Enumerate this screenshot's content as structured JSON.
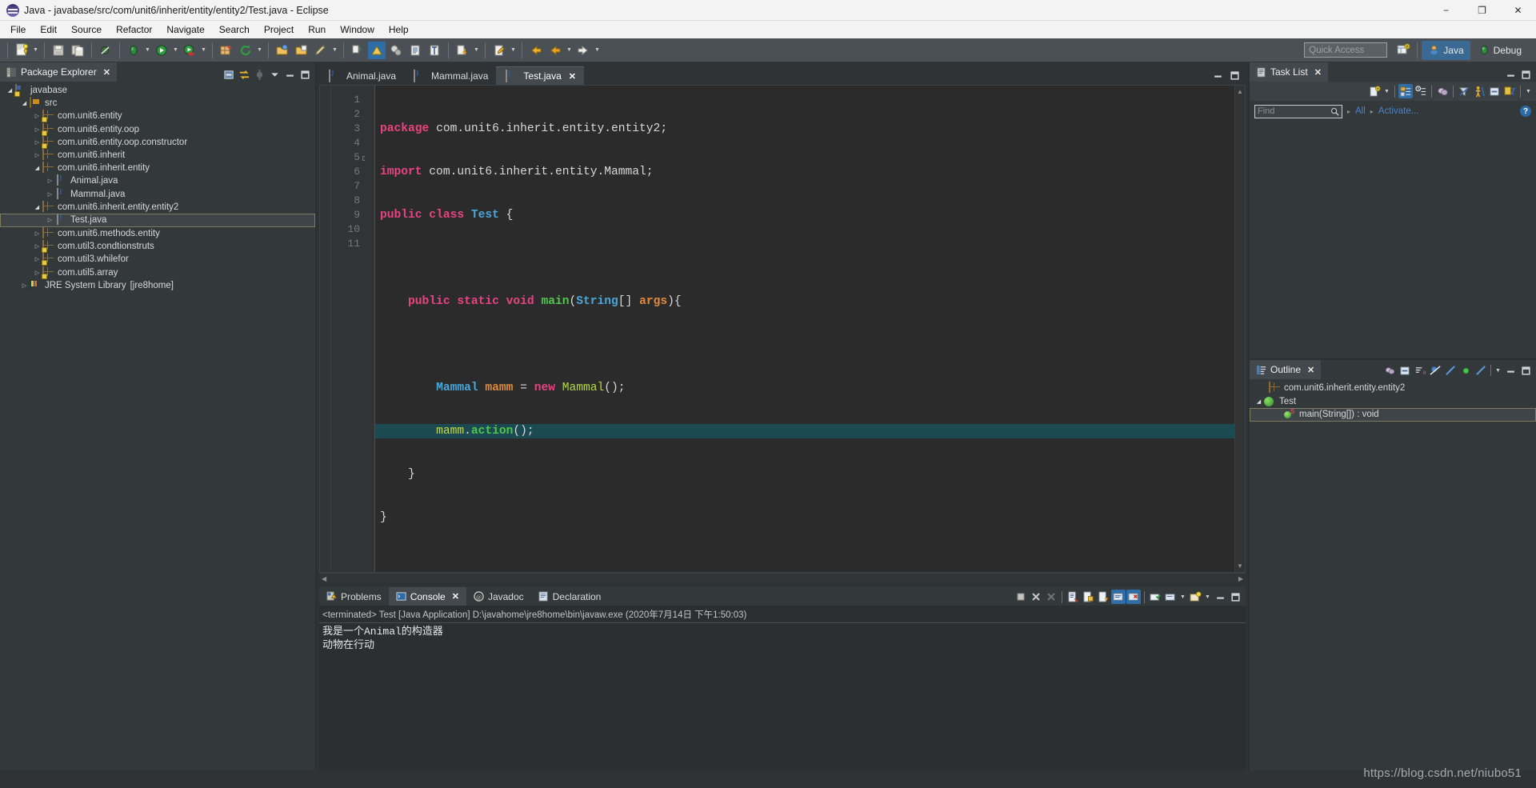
{
  "window": {
    "title": "Java - javabase/src/com/unit6/inherit/entity/entity2/Test.java - Eclipse",
    "minimize": "−",
    "maximize": "❐",
    "close": "✕"
  },
  "menubar": {
    "items": [
      "File",
      "Edit",
      "Source",
      "Refactor",
      "Navigate",
      "Search",
      "Project",
      "Run",
      "Window",
      "Help"
    ]
  },
  "toolbar": {
    "quick_access_placeholder": "Quick Access",
    "perspectives": [
      {
        "label": "Java",
        "active": true
      },
      {
        "label": "Debug",
        "active": false
      }
    ]
  },
  "package_explorer": {
    "tab_label": "Package Explorer",
    "close_glyph": "✕",
    "tree": [
      {
        "label": "javabase",
        "indent": 0,
        "twist": "open",
        "icon": "project-icon"
      },
      {
        "label": "src",
        "indent": 1,
        "twist": "open",
        "icon": "source-folder-icon"
      },
      {
        "label": "com.unit6.entity",
        "indent": 2,
        "twist": "closed",
        "icon": "package-locked-icon"
      },
      {
        "label": "com.unit6.entity.oop",
        "indent": 2,
        "twist": "closed",
        "icon": "package-locked-icon"
      },
      {
        "label": "com.unit6.entity.oop.constructor",
        "indent": 2,
        "twist": "closed",
        "icon": "package-locked-icon"
      },
      {
        "label": "com.unit6.inherit",
        "indent": 2,
        "twist": "closed",
        "icon": "package-icon"
      },
      {
        "label": "com.unit6.inherit.entity",
        "indent": 2,
        "twist": "open",
        "icon": "package-icon"
      },
      {
        "label": "Animal.java",
        "indent": 3,
        "twist": "closed",
        "icon": "java-file-icon"
      },
      {
        "label": "Mammal.java",
        "indent": 3,
        "twist": "closed",
        "icon": "java-file-icon"
      },
      {
        "label": "com.unit6.inherit.entity.entity2",
        "indent": 2,
        "twist": "open",
        "icon": "package-icon"
      },
      {
        "label": "Test.java",
        "indent": 3,
        "twist": "closed",
        "icon": "java-file-icon",
        "selected": true
      },
      {
        "label": "com.unit6.methods.entity",
        "indent": 2,
        "twist": "closed",
        "icon": "package-icon"
      },
      {
        "label": "com.util3.condtionstruts",
        "indent": 2,
        "twist": "closed",
        "icon": "package-locked-icon"
      },
      {
        "label": "com.util3.whilefor",
        "indent": 2,
        "twist": "closed",
        "icon": "package-locked-icon"
      },
      {
        "label": "com.util5.array",
        "indent": 2,
        "twist": "closed",
        "icon": "package-locked-icon"
      },
      {
        "label": "JRE System Library",
        "suffix": "[jre8home]",
        "indent": 1,
        "twist": "closed",
        "icon": "jre-library-icon"
      }
    ]
  },
  "editor": {
    "tabs": [
      {
        "label": "Animal.java",
        "active": false,
        "closable": false
      },
      {
        "label": "Mammal.java",
        "active": false,
        "closable": false
      },
      {
        "label": "Test.java",
        "active": true,
        "closable": true
      }
    ],
    "close_glyph": "✕",
    "line_numbers": [
      1,
      2,
      3,
      4,
      5,
      6,
      7,
      8,
      9,
      10,
      11
    ],
    "highlighted_line": 8,
    "code_lines": [
      {
        "n": 1,
        "tokens": [
          {
            "t": "package",
            "c": "kw"
          },
          {
            "t": " com.unit6.inherit.entity.entity2;",
            "c": "plain"
          }
        ]
      },
      {
        "n": 2,
        "tokens": [
          {
            "t": "import",
            "c": "kw"
          },
          {
            "t": " com.unit6.inherit.entity.Mammal;",
            "c": "plain"
          }
        ]
      },
      {
        "n": 3,
        "tokens": [
          {
            "t": "public class",
            "c": "kw"
          },
          {
            "t": " ",
            "c": "plain"
          },
          {
            "t": "Test",
            "c": "type"
          },
          {
            "t": " {",
            "c": "plain"
          }
        ]
      },
      {
        "n": 4,
        "tokens": [
          {
            "t": "",
            "c": "plain"
          }
        ]
      },
      {
        "n": 5,
        "tokens": [
          {
            "t": "    ",
            "c": "plain"
          },
          {
            "t": "public static void",
            "c": "kw"
          },
          {
            "t": " ",
            "c": "plain"
          },
          {
            "t": "main",
            "c": "green"
          },
          {
            "t": "(",
            "c": "plain"
          },
          {
            "t": "String",
            "c": "type"
          },
          {
            "t": "[] ",
            "c": "plain"
          },
          {
            "t": "args",
            "c": "field"
          },
          {
            "t": "){",
            "c": "plain"
          }
        ]
      },
      {
        "n": 6,
        "tokens": [
          {
            "t": "",
            "c": "plain"
          }
        ]
      },
      {
        "n": 7,
        "tokens": [
          {
            "t": "        ",
            "c": "plain"
          },
          {
            "t": "Mammal",
            "c": "type"
          },
          {
            "t": " ",
            "c": "plain"
          },
          {
            "t": "mamm",
            "c": "field"
          },
          {
            "t": " = ",
            "c": "plain"
          },
          {
            "t": "new",
            "c": "kw"
          },
          {
            "t": " ",
            "c": "plain"
          },
          {
            "t": "Mammal",
            "c": "lime"
          },
          {
            "t": "();",
            "c": "plain"
          }
        ]
      },
      {
        "n": 8,
        "tokens": [
          {
            "t": "        ",
            "c": "plain"
          },
          {
            "t": "mamm",
            "c": "meth"
          },
          {
            "t": ".",
            "c": "plain"
          },
          {
            "t": "action",
            "c": "green"
          },
          {
            "t": "();",
            "c": "plain"
          }
        ]
      },
      {
        "n": 9,
        "tokens": [
          {
            "t": "    }",
            "c": "plain"
          }
        ]
      },
      {
        "n": 10,
        "tokens": [
          {
            "t": "}",
            "c": "plain"
          }
        ]
      },
      {
        "n": 11,
        "tokens": [
          {
            "t": "",
            "c": "plain"
          }
        ]
      }
    ]
  },
  "console": {
    "tabs": [
      {
        "label": "Problems",
        "active": false,
        "closable": false,
        "icon": "problems-icon"
      },
      {
        "label": "Console",
        "active": true,
        "closable": true,
        "icon": "console-icon"
      },
      {
        "label": "Javadoc",
        "active": false,
        "closable": false,
        "icon": "javadoc-icon"
      },
      {
        "label": "Declaration",
        "active": false,
        "closable": false,
        "icon": "declaration-icon"
      }
    ],
    "close_glyph": "✕",
    "status_line": "<terminated> Test [Java Application] D:\\javahome\\jre8home\\bin\\javaw.exe (2020年7月14日 下午1:50:03)",
    "output": "我是一个Animal的构造器\n动物在行动"
  },
  "task_list": {
    "tab_label": "Task List",
    "close_glyph": "✕",
    "find_placeholder": "Find",
    "filter_all": "All",
    "activate_link": "Activate...",
    "help_glyph": "?"
  },
  "outline": {
    "tab_label": "Outline",
    "close_glyph": "✕",
    "items": [
      {
        "label": "com.unit6.inherit.entity.entity2",
        "indent": 0,
        "icon": "package-icon",
        "twist": "none"
      },
      {
        "label": "Test",
        "indent": 0,
        "icon": "class-icon",
        "twist": "open"
      },
      {
        "label": "main(String[]) : void",
        "indent": 1,
        "icon": "method-static-icon",
        "twist": "none",
        "selected": true
      }
    ]
  },
  "watermark": {
    "text": "https://blog.csdn.net/niubo51"
  },
  "colors": {
    "accent_blue": "#2e6ea8",
    "selection_teal": "#1b4a52",
    "keyword_pink": "#e8447f",
    "type_blue": "#4aa8d8",
    "method_green": "#4ec94e",
    "field_orange": "#e08a3c",
    "panel_bg": "#33383b",
    "editor_bg": "#2b2b2b"
  }
}
